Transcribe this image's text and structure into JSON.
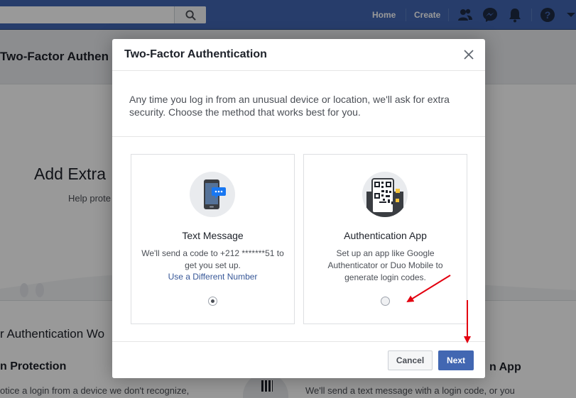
{
  "topbar": {
    "nav": {
      "home": "Home",
      "create": "Create"
    },
    "icons": [
      "search-icon",
      "friends-icon",
      "messenger-icon",
      "notifications-icon",
      "help-icon",
      "chevron-down-icon"
    ]
  },
  "background": {
    "page_title": "Two-Factor Authen",
    "hero_heading": "Add Extra",
    "hero_text": "Help prote",
    "section_heading": "r Authentication Wo",
    "left_heading": "n Protection",
    "left_text": "otice a login from a device we don't recognize,",
    "right_heading": "n App",
    "right_text": "We'll send a text message with a login code, or you"
  },
  "dialog": {
    "title": "Two-Factor Authentication",
    "intro": "Any time you log in from an unusual device or location, we'll ask for extra security. Choose the method that works best for you.",
    "options": [
      {
        "title": "Text Message",
        "description": "We'll send a code to +212 *******51 to get you set up.",
        "link": "Use a Different Number",
        "selected": true,
        "icon": "phone-message-icon"
      },
      {
        "title": "Authentication App",
        "description": "Set up an app like Google Authenticator or Duo Mobile to generate login codes.",
        "selected": false,
        "icon": "qr-code-icon"
      }
    ],
    "buttons": {
      "cancel": "Cancel",
      "next": "Next"
    }
  },
  "colors": {
    "brand": "#4267b2",
    "annotation_arrow": "#e3000f",
    "link": "#385898"
  }
}
